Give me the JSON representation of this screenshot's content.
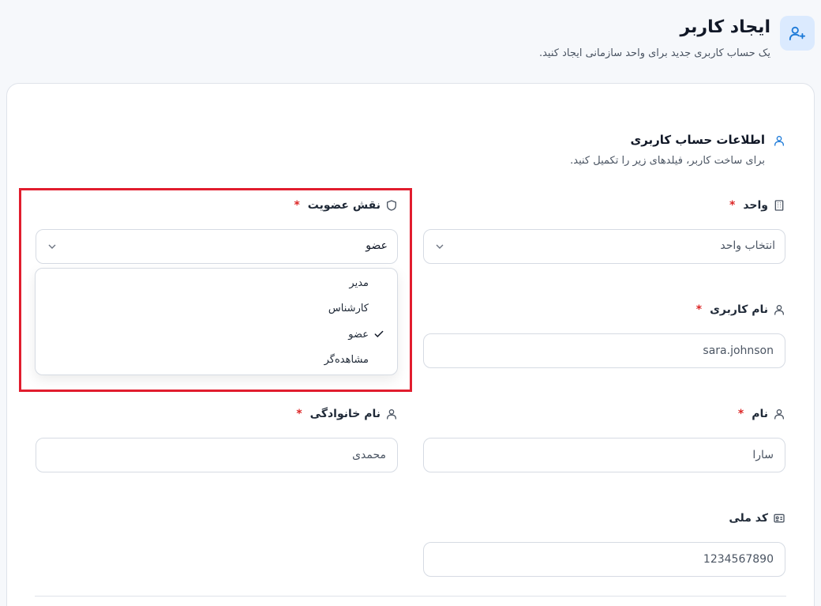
{
  "header": {
    "title": "ایجاد کاربر",
    "subtitle": "یک حساب کاربری جدید برای واحد سازمانی ایجاد کنید."
  },
  "section": {
    "title": "اطلاعات حساب کاربری",
    "subtitle": "برای ساخت کاربر، فیلدهای زیر را تکمیل کنید."
  },
  "fields": {
    "unit": {
      "label": "واحد",
      "required_mark": "*",
      "placeholder": "انتخاب واحد"
    },
    "role": {
      "label": "نقش عضویت",
      "required_mark": "*",
      "value": "عضو"
    },
    "username": {
      "label": "نام کاربری",
      "required_mark": "*",
      "value": "sara.johnson"
    },
    "first_name": {
      "label": "نام",
      "required_mark": "*",
      "value": "سارا"
    },
    "last_name": {
      "label": "نام خانوادگی",
      "required_mark": "*",
      "value": "محمدی"
    },
    "national_id": {
      "label": "کد ملی",
      "value": "1234567890"
    }
  },
  "role_options": [
    {
      "label": "مدیر",
      "selected": false
    },
    {
      "label": "کارشناس",
      "selected": false
    },
    {
      "label": "عضو",
      "selected": true
    },
    {
      "label": "مشاهده‌گر",
      "selected": false
    }
  ],
  "colors": {
    "accent": "#1d7ad8",
    "required": "#dc2626",
    "highlight": "#e11d2e"
  }
}
